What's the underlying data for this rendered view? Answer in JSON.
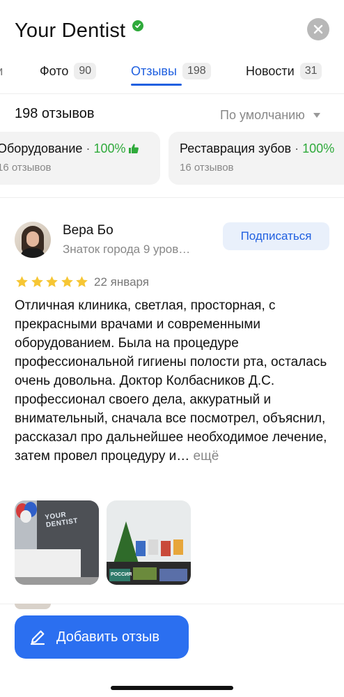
{
  "header": {
    "title": "Your Dentist",
    "verified_icon": "verified-check-icon",
    "close_icon": "close-icon"
  },
  "tabs": [
    {
      "label": "ти",
      "count": ""
    },
    {
      "label": "Фото",
      "count": "90"
    },
    {
      "label": "Отзывы",
      "count": "198",
      "active": true
    },
    {
      "label": "Новости",
      "count": "31"
    }
  ],
  "summary": {
    "count_label": "198 отзывов",
    "sort_label": "По умолчанию"
  },
  "aspects": [
    {
      "name": "Оборудование",
      "separator": "·",
      "percent": "100%",
      "reviews": "16 отзывов",
      "icon": "thumbs-up-icon"
    },
    {
      "name": "Реставрация зубов",
      "separator": "·",
      "percent": "100%",
      "reviews": "16 отзывов"
    }
  ],
  "review": {
    "author": "Вера Бо",
    "level": "Знаток города 9 уров…",
    "subscribe_label": "Подписаться",
    "rating": 5,
    "date": "22 января",
    "text": "Отличная клиника, светлая, просторная, с прекрасными врачами и современными оборудованием. Была на процедуре профессиональной гигиены полости рта, осталась очень довольна. Доктор Колбасников Д.С. профессионал своего дела, аккуратный и внимательный, сначала все посмотрел, объяснил, рассказал про дальнейшее необходимое лечение, затем провел процедуру и…",
    "more_label": "ещё",
    "photo_1_logo": "YOUR DENTIST",
    "photo_2_label": "РОССИЯ"
  },
  "actions": {
    "add_review_label": "Добавить отзыв",
    "add_review_icon": "pencil-icon"
  },
  "colors": {
    "accent": "#2060e0",
    "button": "#2b6ff0",
    "positive": "#2faa3b",
    "star": "#f6c634"
  }
}
